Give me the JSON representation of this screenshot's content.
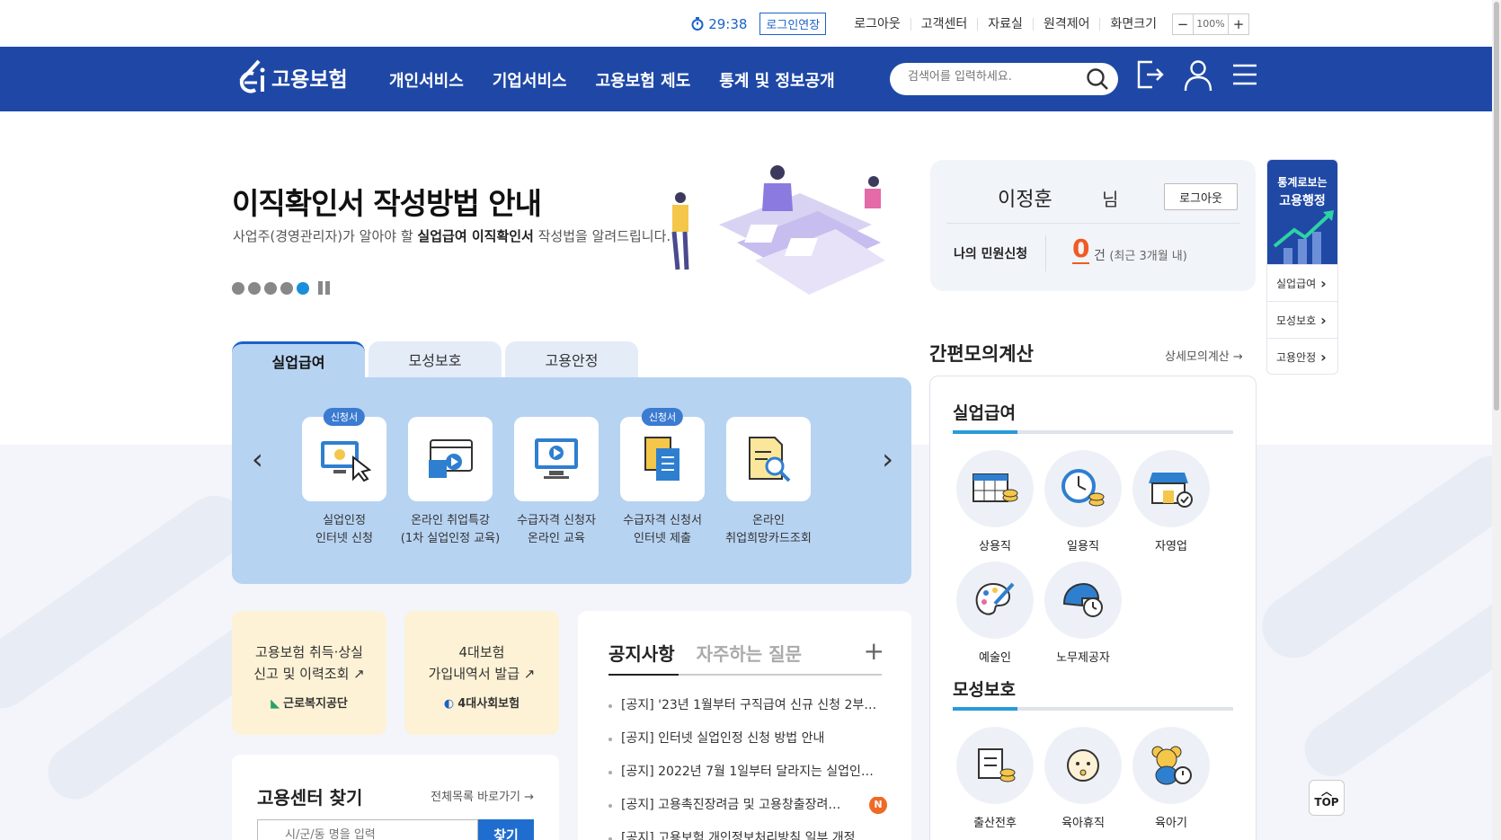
{
  "util": {
    "timer": "29:38",
    "extend_label": "로그인연장",
    "links": [
      "로그아웃",
      "고객센터",
      "자료실",
      "원격제어",
      "화면크기"
    ],
    "zoom_minus": "−",
    "zoom_value": "100%",
    "zoom_plus": "+"
  },
  "gnb": {
    "logo_text": "고용보험",
    "menu": [
      "개인서비스",
      "기업서비스",
      "고용보험 제도",
      "통계 및 정보공개"
    ],
    "search_placeholder": "검색어를 입력하세요."
  },
  "hero": {
    "title": "이직확인서 작성방법 안내",
    "sub_pre": "사업주(경영관리자)가 알아야 할 ",
    "sub_bold": "실업급여 이직확인서",
    "sub_post": " 작성법을 알려드립니다.",
    "dots_total": 5,
    "dots_active": 5
  },
  "user": {
    "name": "이정훈",
    "suffix": "님",
    "logout_label": "로그아웃",
    "my_label": "나의 민원신청",
    "count": "0",
    "count_unit": "건",
    "count_note": "(최근 3개월 내)"
  },
  "quick": {
    "head_line1": "통계로보는",
    "head_line2": "고용행정",
    "items": [
      "실업급여",
      "모성보호",
      "고용안정"
    ]
  },
  "tabs": [
    "실업급여",
    "모성보호",
    "고용안정"
  ],
  "services": [
    {
      "badge": "신청서",
      "line1": "실업인정",
      "line2": "인터넷 신청"
    },
    {
      "badge": "",
      "line1": "온라인 취업특강",
      "line2": "(1차 실업인정 교육)"
    },
    {
      "badge": "",
      "line1": "수급자격 신청자",
      "line2": "온라인 교육"
    },
    {
      "badge": "신청서",
      "line1": "수급자격 신청서",
      "line2": "인터넷 제출"
    },
    {
      "badge": "",
      "line1": "온라인",
      "line2": "취업희망카드조회"
    }
  ],
  "links": [
    {
      "line1": "고용보험 취득·상실",
      "line2": "신고 및 이력조회",
      "org": "근로복지공단"
    },
    {
      "line1": "4대보험",
      "line2": "가입내역서 발급",
      "org": "4대사회보험"
    }
  ],
  "notice": {
    "tab_on": "공지사항",
    "tab_off": "자주하는 질문",
    "plus": "+",
    "items": [
      {
        "text": "[공지] '23년 1월부터 구직급여 신규 신청 2부…",
        "new": ""
      },
      {
        "text": "[공지] 인터넷 실업인정 신청 방법 안내",
        "new": ""
      },
      {
        "text": "[공지] 2022년 7월 1일부터 달라지는 실업인…",
        "new": ""
      },
      {
        "text": "[공지] 고용촉진장려금 및 고용창출장려…",
        "new": "N"
      },
      {
        "text": "[공지] 고용보험 개인정보처리방침 일부 개정",
        "new": ""
      }
    ]
  },
  "finder": {
    "title": "고용센터 찾기",
    "link": "전체목록 바로가기",
    "placeholder": "시/군/동 명을 입력",
    "button": "찾기"
  },
  "calc": {
    "title": "간편모의계산",
    "link": "상세모의계산",
    "sections": [
      {
        "title": "실업급여",
        "items": [
          "상용직",
          "일용직",
          "자영업",
          "예술인",
          "노무제공자"
        ]
      },
      {
        "title": "모성보호",
        "items": [
          "출산전후",
          "육아휴직",
          "육아기"
        ]
      }
    ]
  },
  "top_label": "TOP"
}
